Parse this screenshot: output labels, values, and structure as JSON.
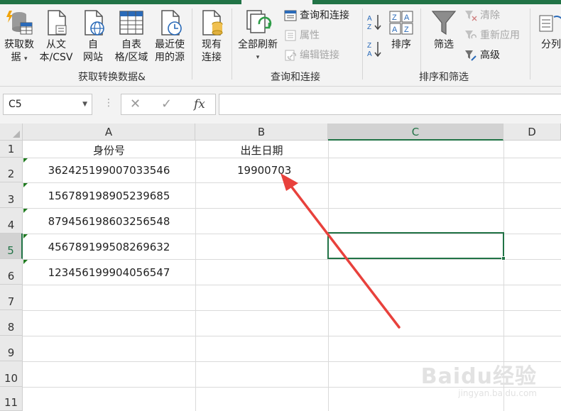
{
  "ribbon": {
    "groups": {
      "get_transform": {
        "label": "获取转换数据&",
        "buttons": [
          {
            "line1": "获取数",
            "line2": "据",
            "has_dropdown": true,
            "icon": "database-icon"
          },
          {
            "line1": "从文",
            "line2": "本/CSV",
            "icon": "text-file-icon"
          },
          {
            "line1": "自",
            "line2": "网站",
            "icon": "web-icon"
          },
          {
            "line1": "自表",
            "line2": "格/区域",
            "icon": "table-icon"
          },
          {
            "line1": "最近使",
            "line2": "用的源",
            "icon": "recent-source-icon"
          },
          {
            "line1": "现有",
            "line2": "连接",
            "icon": "existing-connection-icon"
          }
        ]
      },
      "query_connection": {
        "label": "查询和连接",
        "refresh_all": {
          "label": "全部刷新",
          "has_dropdown": true,
          "icon": "refresh-icon"
        },
        "items": [
          {
            "label": "查询和连接",
            "enabled": true,
            "icon": "query-connection-icon"
          },
          {
            "label": "属性",
            "enabled": false,
            "icon": "properties-icon"
          },
          {
            "label": "编辑链接",
            "enabled": false,
            "icon": "edit-links-icon"
          }
        ]
      },
      "sort_filter": {
        "label": "排序和筛选",
        "sort_label": "排序",
        "filter_label": "筛选",
        "items": [
          {
            "label": "清除",
            "enabled": false,
            "icon": "clear-filter-icon"
          },
          {
            "label": "重新应用",
            "enabled": false,
            "icon": "reapply-icon"
          },
          {
            "label": "高级",
            "enabled": true,
            "icon": "advanced-filter-icon"
          }
        ]
      },
      "data_tools": {
        "split_label": "分列"
      }
    }
  },
  "formula_bar": {
    "name_box": "C5",
    "fx_label": "fx",
    "formula": ""
  },
  "sheet": {
    "columns": [
      "A",
      "B",
      "C",
      "D"
    ],
    "selected_column": "C",
    "rows": [
      "1",
      "2",
      "3",
      "4",
      "5",
      "6",
      "7",
      "8",
      "9",
      "10",
      "11"
    ],
    "selected_row": "5",
    "cells": {
      "A1": "身份号",
      "B1": "出生日期",
      "A2": "362425199007033546",
      "B2": "19900703",
      "A3": "156789198905239685",
      "A4": "879456198603256548",
      "A5": "456789199508269632",
      "A6": "123456199904056547"
    },
    "active_cell": "C5"
  },
  "annotation": {
    "type": "red-arrow",
    "color": "#e8413c"
  },
  "watermark": {
    "main": "Baidu经验",
    "sub": "jingyan.baidu.com"
  }
}
